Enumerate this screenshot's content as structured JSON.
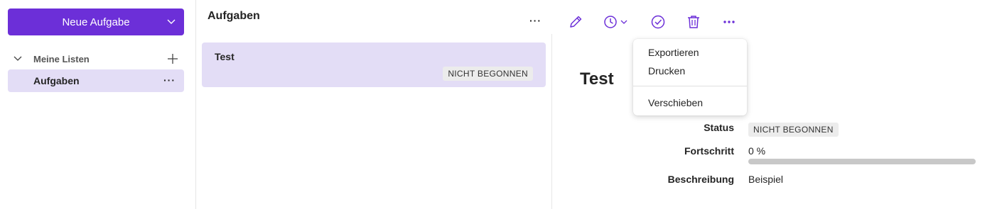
{
  "sidebar": {
    "new_task_label": "Neue Aufgabe",
    "lists_header": "Meine Listen",
    "items": [
      {
        "label": "Aufgaben",
        "selected": true
      }
    ]
  },
  "list_pane": {
    "title": "Aufgaben",
    "tasks": [
      {
        "title": "Test",
        "status": "NICHT BEGONNEN"
      }
    ]
  },
  "toolbar": {
    "icons": [
      "edit-icon",
      "clock-icon",
      "complete-icon",
      "delete-icon",
      "more-icon"
    ]
  },
  "detail": {
    "title": "Test",
    "status_label": "Status",
    "status_value": "NICHT BEGONNEN",
    "progress_label": "Fortschritt",
    "progress_value": "0 %",
    "progress_fraction": 0,
    "description_label": "Beschreibung",
    "description_value": "Beispiel"
  },
  "menu": {
    "items": [
      "Exportieren",
      "Drucken",
      "Verschieben"
    ]
  },
  "colors": {
    "accent": "#6c2fd8",
    "selection": "#e3ddf6",
    "badge_bg": "#ececec"
  }
}
